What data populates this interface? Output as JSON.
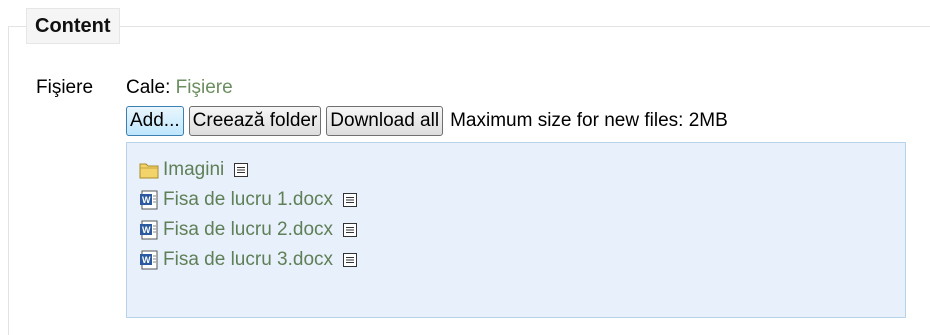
{
  "section": {
    "legend": "Content"
  },
  "field": {
    "label": "Fişiere"
  },
  "path": {
    "prefix": "Cale: ",
    "link": "Fişiere"
  },
  "toolbar": {
    "add_label": "Add...",
    "create_folder_label": "Creează folder",
    "download_all_label": "Download all",
    "max_size_text": "Maximum size for new files: 2MB"
  },
  "files": [
    {
      "name": "Imagini",
      "icon": "folder-icon"
    },
    {
      "name": "Fisa de lucru 1.docx",
      "icon": "word-document-icon"
    },
    {
      "name": "Fisa de lucru 2.docx",
      "icon": "word-document-icon"
    },
    {
      "name": "Fisa de lucru 3.docx",
      "icon": "word-document-icon"
    }
  ],
  "colors": {
    "link": "#6b8e5e",
    "filebox_bg": "#e8f1fb",
    "filebox_border": "#b6d3ea"
  }
}
